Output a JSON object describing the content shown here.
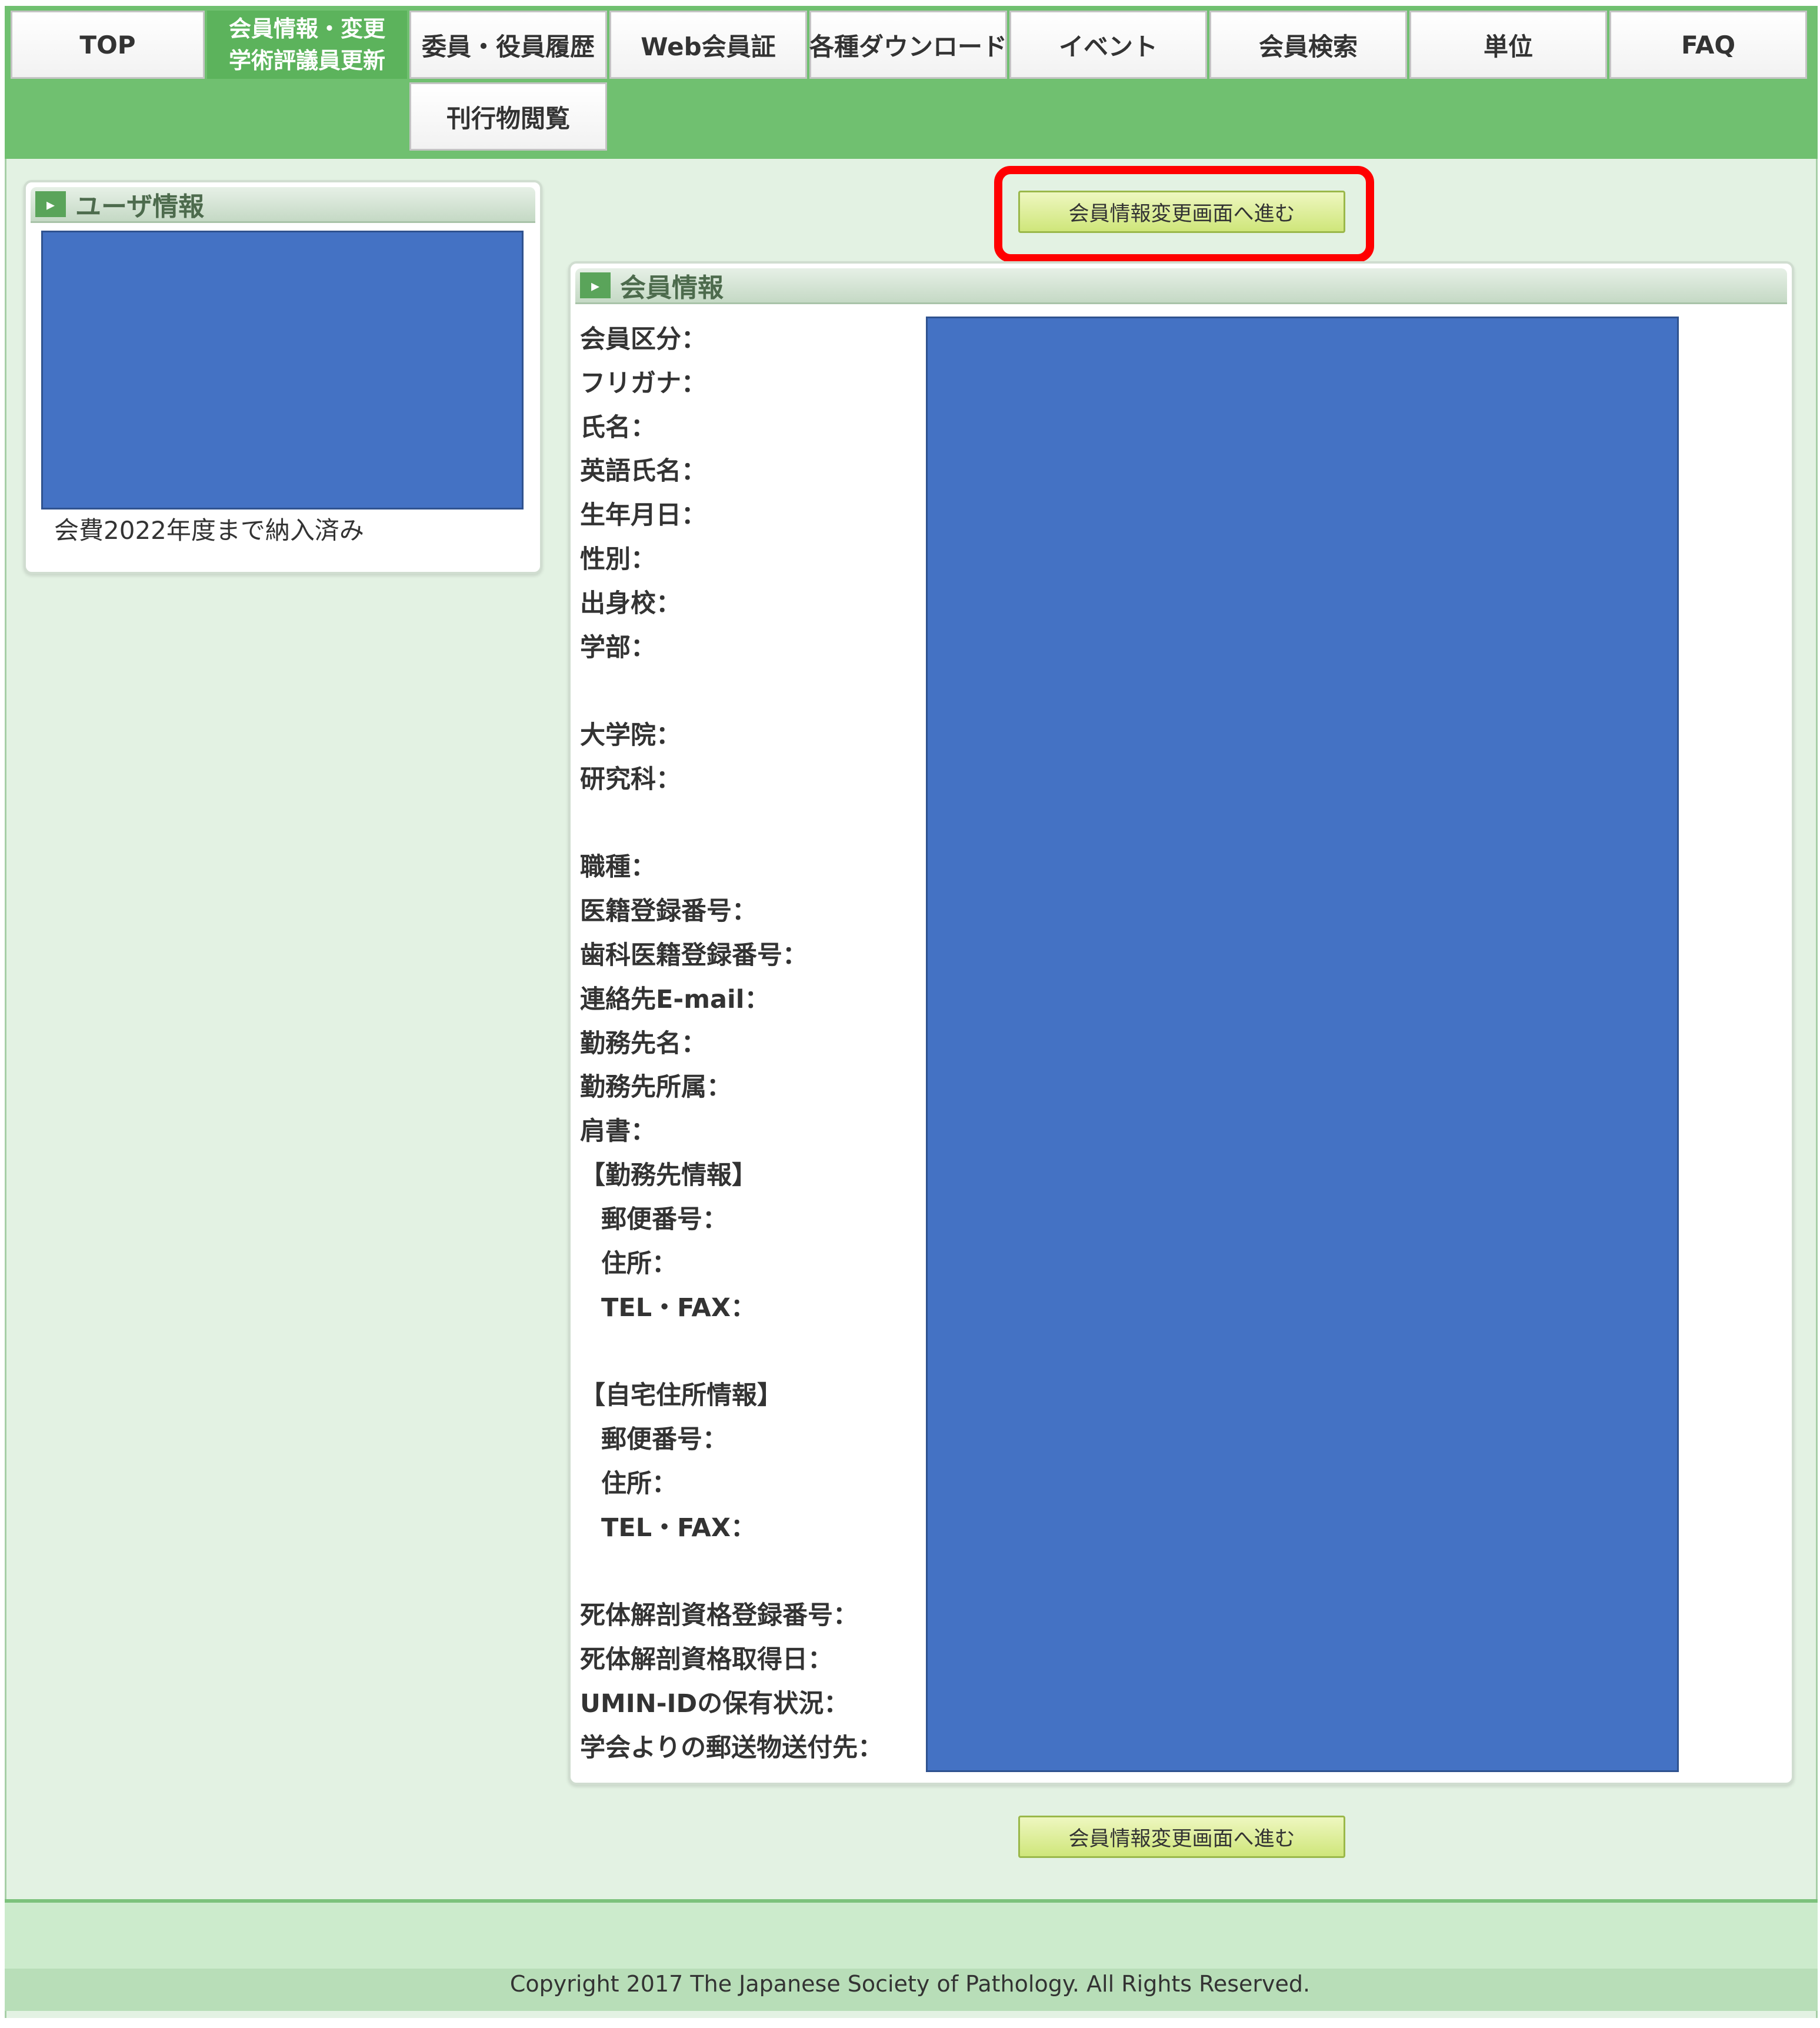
{
  "nav": {
    "top": "TOP",
    "member_info_line1": "会員情報・変更",
    "member_info_line2": "学術評議員更新",
    "committee": "委員・役員履歴",
    "web_card": "Web会員証",
    "downloads": "各種ダウンロード",
    "events": "イベント",
    "member_search": "会員検索",
    "credits": "単位",
    "faq": "FAQ",
    "publications": "刊行物閲覧"
  },
  "user_panel": {
    "title": "ユーザ情報",
    "fee_status": "会費2022年度まで納入済み"
  },
  "member_panel": {
    "title": "会員情報",
    "labels": [
      "会員区分：",
      "フリガナ：",
      "氏名：",
      "英語氏名：",
      "生年月日：",
      "性別：",
      "出身校：",
      "学部：",
      "大学院：",
      "研究科：",
      "職種：",
      "医籍登録番号：",
      "歯科医籍登録番号：",
      "連絡先E-mail：",
      "勤務先名：",
      "勤務先所属：",
      "肩書：",
      "【勤務先情報】",
      "郵便番号：",
      "住所：",
      "TEL・FAX：",
      "【自宅住所情報】",
      "郵便番号：",
      "住所：",
      "TEL・FAX：",
      "死体解剖資格登録番号：",
      "死体解剖資格取得日：",
      "UMIN-IDの保有状況：",
      "学会よりの郵送物送付先："
    ]
  },
  "actions": {
    "proceed_label": "会員情報変更画面へ進む"
  },
  "footer": {
    "copyright": "Copyright 2017 The Japanese Society of Pathology. All Rights Reserved."
  },
  "colors": {
    "nav_green": "#70c070",
    "active_tab": "#5cb35c",
    "page_bg": "#e3f2e3",
    "redaction": "#4472c4",
    "highlight": "#ff0000",
    "button_bg": "#cfe67a"
  }
}
